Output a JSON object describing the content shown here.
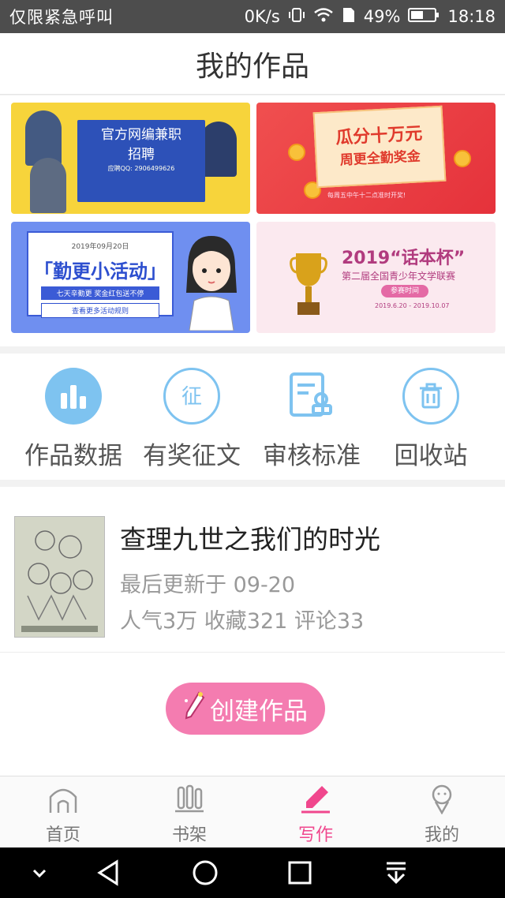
{
  "status_bar": {
    "carrier": "仅限紧急呼叫",
    "speed": "0K/s",
    "battery": "49%",
    "time": "18:18"
  },
  "header": {
    "title": "我的作品"
  },
  "banners": {
    "recruit": {
      "line1": "官方网编兼职",
      "line2": "招聘",
      "qq": "应聘QQ: 2906499626"
    },
    "reward": {
      "line1": "瓜分十万元",
      "line2": "周更全勤奖金",
      "note": "每周五中午十二点准时开奖!"
    },
    "activity": {
      "date": "2019年09月20日",
      "title": "「勤更小活动」",
      "tagline": "七天辛勤更 奖金红包送不停",
      "more": "查看更多活动规则"
    },
    "contest": {
      "title": "2019“话本杯”",
      "subtitle": "第二届全国青少年文学联赛",
      "pill": "参赛时间",
      "dates": "2019.6.20 - 2019.10.07"
    }
  },
  "functions": [
    {
      "label": "作品数据",
      "icon": "bar-chart-icon"
    },
    {
      "label": "有奖征文",
      "icon": "contest-icon"
    },
    {
      "label": "审核标准",
      "icon": "review-standard-icon"
    },
    {
      "label": "回收站",
      "icon": "trash-icon"
    }
  ],
  "works": [
    {
      "title": "查理九世之我们的时光",
      "updated": "最后更新于 09-20",
      "stats": "人气3万 收藏321 评论33"
    }
  ],
  "create_button": {
    "label": "创建作品",
    "icon": "pencil-icon"
  },
  "tabs": [
    {
      "label": "首页",
      "icon": "home-icon",
      "active": false
    },
    {
      "label": "书架",
      "icon": "bookshelf-icon",
      "active": false
    },
    {
      "label": "写作",
      "icon": "write-icon",
      "active": true
    },
    {
      "label": "我的",
      "icon": "profile-icon",
      "active": false
    }
  ],
  "colors": {
    "accent": "#f0478d",
    "button": "#f47cb0",
    "icon_blue": "#7ec3f0"
  }
}
